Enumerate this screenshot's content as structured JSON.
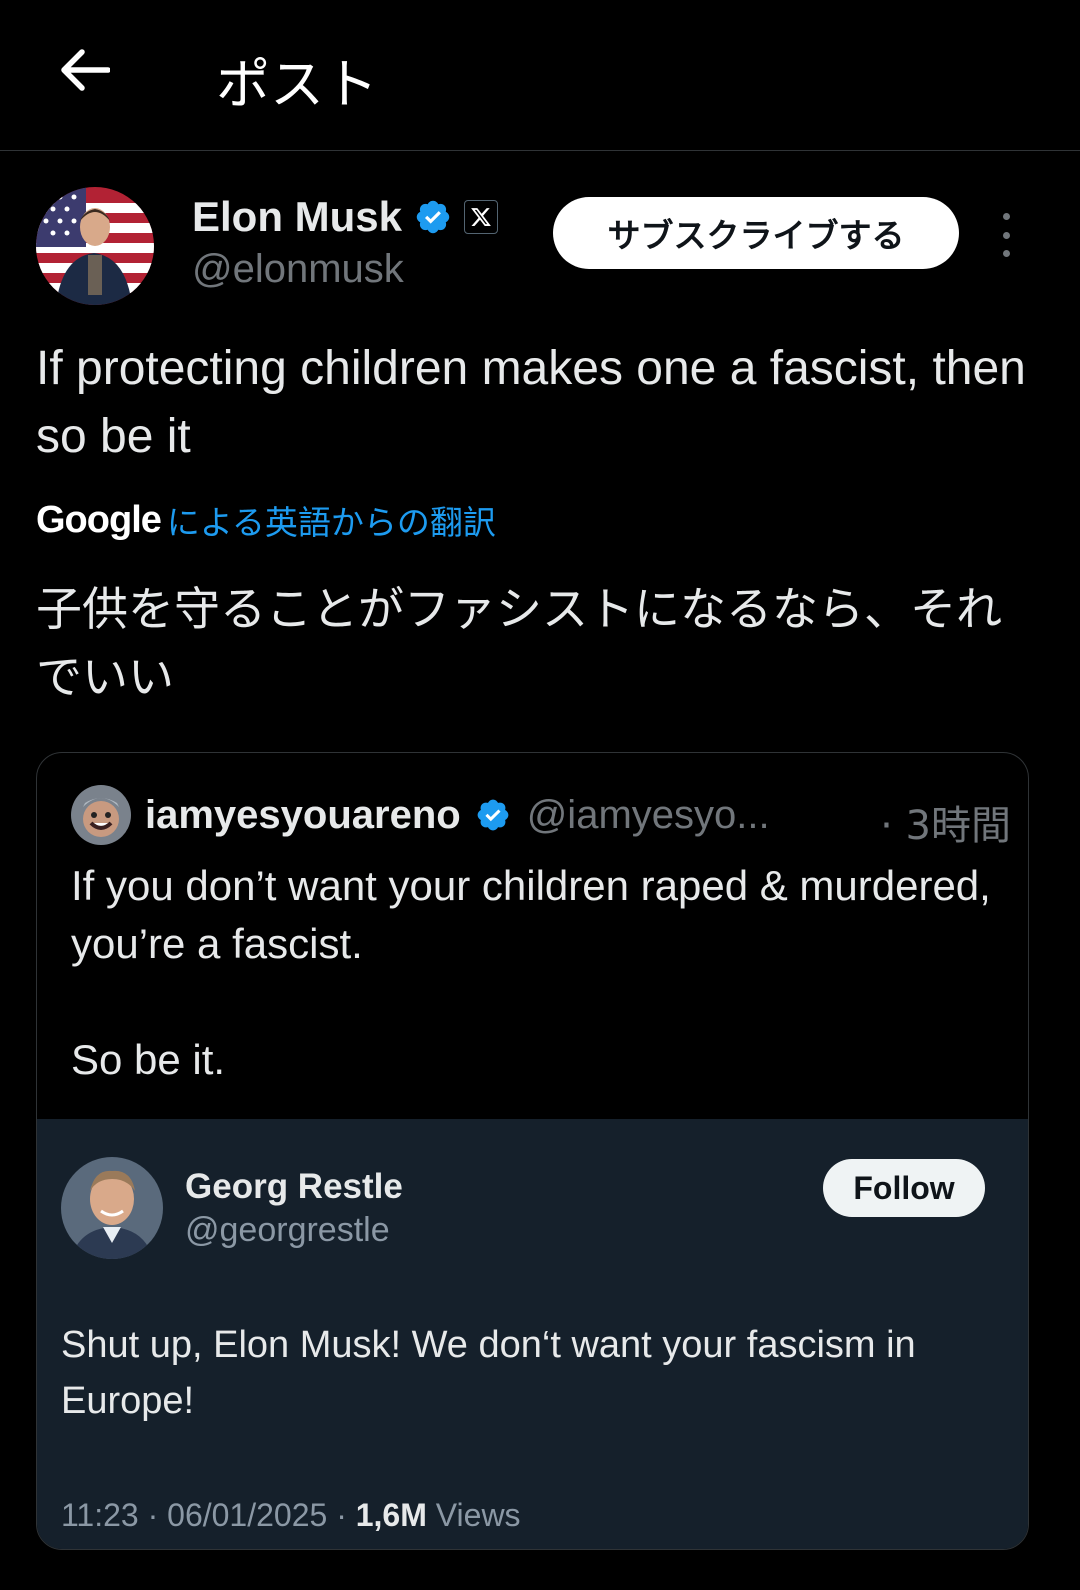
{
  "header": {
    "title": "ポスト"
  },
  "author": {
    "name": "Elon Musk",
    "handle": "@elonmusk",
    "subscribe_label": "サブスクライブする"
  },
  "post": {
    "text": "If protecting children makes one a fascist, then so be it",
    "translation_brand": "Google",
    "translation_label": "による英語からの翻訳",
    "translated_text": "子供を守ることがファシストになるなら、それでいい"
  },
  "quote": {
    "name": "iamyesyouareno",
    "handle": "@iamyesyo...",
    "time": "· 3時間",
    "text": "If you don’t want your children raped & murdered, you’re a fascist.\n\nSo be it."
  },
  "embed": {
    "name": "Georg Restle",
    "handle": "@georgrestle",
    "follow_label": "Follow",
    "text": "Shut up, Elon Musk! We don‘t want your fascism in Europe!",
    "time": "11:23 · 06/01/2025 · ",
    "views_count": "1,6M",
    "views_label": " Views"
  },
  "colors": {
    "background": "#000000",
    "link": "#1d9bf0",
    "verified": "#1d9bf0",
    "secondary_text": "#71767b",
    "embed_bg": "#15202b"
  },
  "icons": {
    "back": "arrow-left-icon",
    "verified": "verified-badge-icon",
    "x": "x-logo-icon",
    "more": "more-vertical-icon"
  }
}
